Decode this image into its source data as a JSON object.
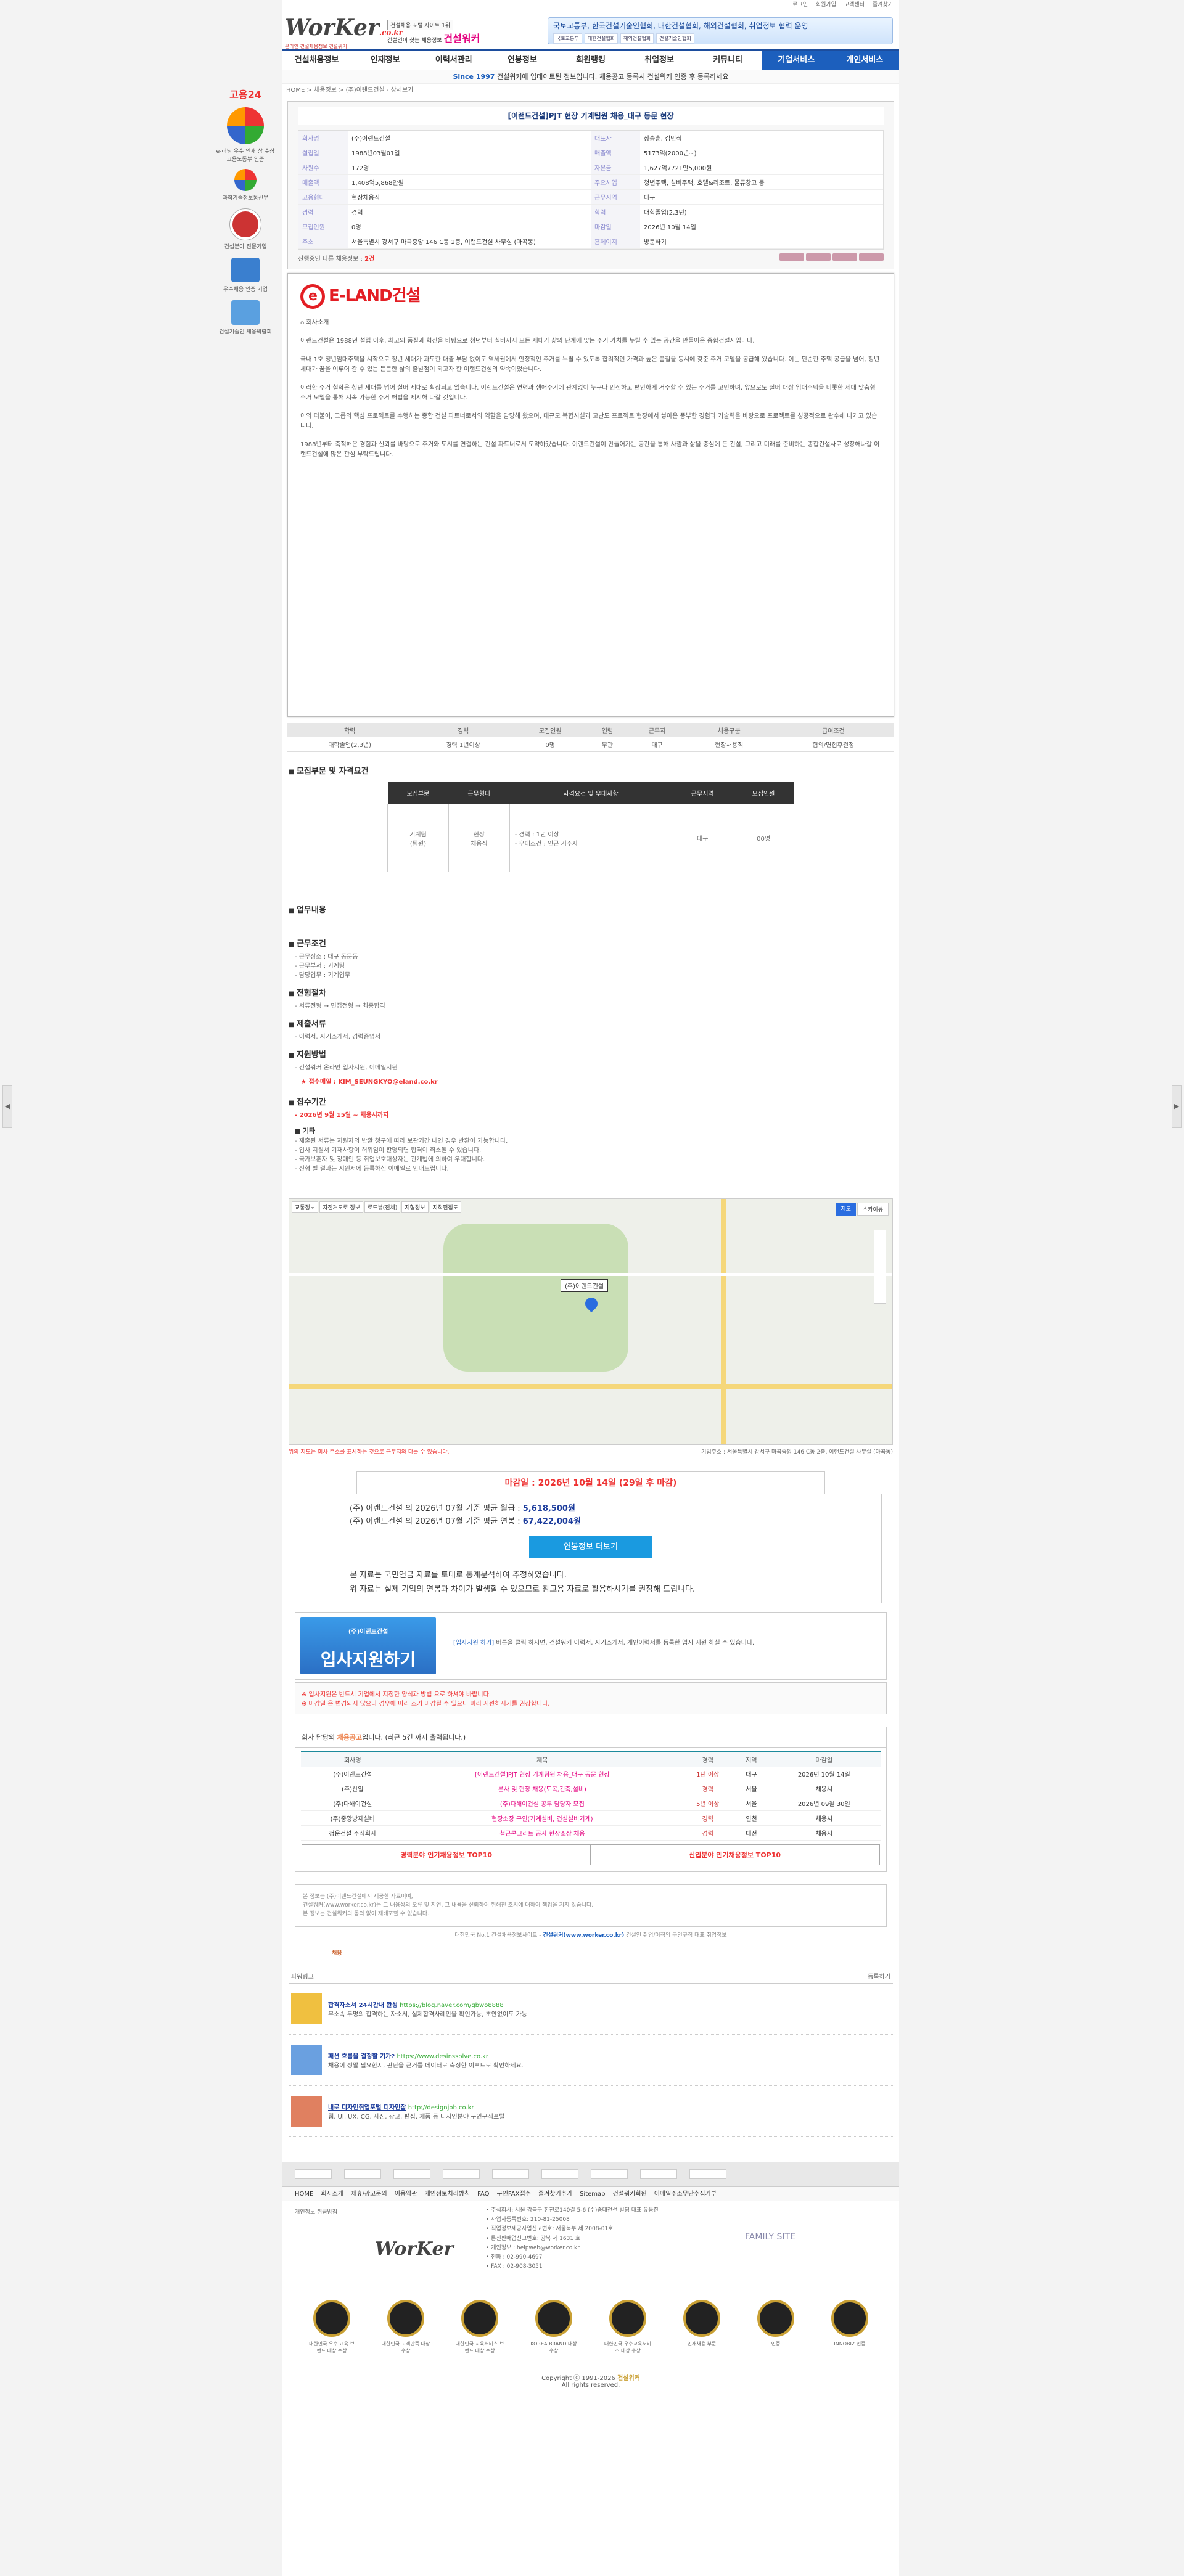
{
  "top_links": [
    "로그인",
    "회원가입",
    "고객센터",
    "즐겨찾기"
  ],
  "header": {
    "logo": "WorKer",
    "logo_suffix": ".co.kr",
    "logo_sub": "온라인 건설채용정보 건설워커",
    "badge": "건설채용 포털 사이트 1위",
    "slogan": "건설인이 찾는 채용정보",
    "brand": "건설워커",
    "banner_title": "국토교통부, 한국건설기술인협회, 대한건설협회, 해외건설협회, 취업정보 협력 운영",
    "banner_links": [
      "국토교통부",
      "대한건설협회",
      "해외건설협회",
      "건설기술인협회"
    ]
  },
  "menu": [
    "건설채용정보",
    "인재정보",
    "이력서관리",
    "연봉정보",
    "회원랭킹",
    "취업정보",
    "커뮤니티",
    "기업서비스",
    "개인서비스"
  ],
  "notice": {
    "highlight": "Since 1997",
    "text": "건설워커에 업데이트된 정보입니다. 채용공고 등록시 건설워커 인증 후 등록하세요"
  },
  "breadcrumb": "HOME  > 채용정보  > (주)이랜드건설 - 상세보기",
  "side": {
    "g24": "고용24",
    "badge1": "e-러닝 우수 인재 상 수상 고용노동부 인증",
    "badge2": "과학기술정보통신부",
    "seal": "건설분야 전문기업",
    "sq": "우수채용 인증 기업",
    "sq2": "건설기술인 채용박람회"
  },
  "summary": {
    "title": "[이랜드건설]PJT 현장 기계팀원 채용_대구 동문 현장",
    "rows": [
      [
        "회사명",
        "(주)이랜드건설",
        "대표자",
        "장승훈, 김민식"
      ],
      [
        "설립일",
        "1988년03월01일",
        "매출액",
        "5173억(2000년~)"
      ],
      [
        "사원수",
        "172명",
        "자본금",
        "1,627억7721만5,000원"
      ],
      [
        "매출액",
        "1,408억5,868만원",
        "주요사업",
        "청년주택, 실버주택, 호텔&리조트, 물류창고 등"
      ],
      [
        "고용형태",
        "현장채용직",
        "근무지역",
        "대구"
      ],
      [
        "경력",
        "경력",
        "학력",
        "대학졸업(2,3년)"
      ],
      [
        "모집인원",
        "0명",
        "마감일",
        "2026년 10월 14일"
      ],
      [
        "주소",
        "서울특별시 강서구 마곡중앙 146 C동 2층, 이랜드건설 사무실 (마곡동)",
        "홈페이지",
        "방문하기"
      ]
    ],
    "count_label": "진행중인 다른 채용정보 :",
    "count": "2건"
  },
  "detail": {
    "logo": "E-LAND건설",
    "menu_label": "회사소개",
    "paras": [
      "이랜드건설은 1988년 설립 이후, 최고의 품질과 혁신을 바탕으로 청년부터 실버까지 모든 세대가 삶의 단계에 맞는 주거 가치를 누릴 수 있는 공간을 만들어온 종합건설사입니다.",
      "국내 1호 청년임대주택을 시작으로 청년 세대가 과도한 대출 부담 없이도 역세권에서 안정적인 주거를 누릴 수 있도록 합리적인 가격과 높은 품질을 동시에 갖춘 주거 모델을 공급해 왔습니다. 이는 단순한 주택 공급을 넘어, 청년 세대가 꿈을 이루어 갈 수 있는 든든한 삶의 출발점이 되고자 한 이랜드건설의 약속이었습니다.",
      "이러한 주거 철학은 청년 세대를 넘어 실버 세대로 확장되고 있습니다. 이랜드건설은 연령과 생애주기에 관계없이 누구나 안전하고 편안하게 거주할 수 있는 주거를 고민하며, 앞으로도 실버 대상 임대주택을 비롯한 세대 맞춤형 주거 모델을 통해 지속 가능한 주거 해법을 제시해 나갈 것입니다.",
      "이와 더불어, 그룹의 핵심 프로젝트를 수행하는 종합 건설 파트너로서의 역할을 담당해 왔으며, 대규모 복합시설과 고난도 프로젝트 현장에서 쌓아온 풍부한 경험과 기술력을 바탕으로 프로젝트를 성공적으로 완수해 나가고 있습니다.",
      "1988년부터 축적해온 경험과 신뢰를 바탕으로 주거와 도시를 연결하는 건설 파트너로서 도약하겠습니다. 이랜드건설이 만들어가는 공간을 통해 사람과 삶을 중심에 둔 건설, 그리고 미래를 준비하는 종합건설사로 성장해나갈 이랜드건설에 많은 관심 부탁드립니다."
    ]
  },
  "conditions": {
    "headers": [
      "학력",
      "경력",
      "모집인원",
      "연령",
      "근무지",
      "채용구분",
      "급여조건"
    ],
    "values": [
      "대학졸업(2,3년)",
      "경력 1년이상",
      "0명",
      "무관",
      "대구",
      "현장채용직",
      "협의/면접후결정"
    ]
  },
  "sections": {
    "req": "모집부문 및 자격요건",
    "job": "업무내용",
    "work": "근무조건",
    "proc": "전형절차",
    "docs": "제출서류",
    "apply": "지원방법",
    "period": "접수기간",
    "etc": "기타"
  },
  "req_table": {
    "headers": [
      "모집부문",
      "근무형태",
      "자격요건 및 우대사항",
      "근무지역",
      "모집인원"
    ],
    "row": [
      "기계팀\n(팀원)",
      "현장\n채용직",
      "- 경력 : 1년 이상\n- 우대조건 : 인근 거주자",
      "대구",
      "00명"
    ]
  },
  "work_lines": [
    "- 근무장소 : 대구 동문동",
    "- 근무부서 : 기계팀",
    "- 담당업무 : 기계업무"
  ],
  "proc_line": "- 서류전형 → 면접전형 → 최종합격",
  "docs_line": "- 이력서, 자기소개서, 경력증명서",
  "apply_lines": [
    "- 건설워커 온라인 입사지원, 이메일지원"
  ],
  "apply_email": "★ 접수메일 : KIM_SEUNGKYO@eland.co.kr",
  "period_line": "- 2026년 9월 15일 ~ 채용시까지",
  "etc_lines": [
    "- 제출된 서류는 지원자의 반환 청구에 따라 보관기간 내인 경우 반환이 가능합니다.",
    "- 입사 지원서 기재사항이 허위임이 판명되면 합격이 취소될 수 있습니다.",
    "- 국가보훈자 및 장애인 등 취업보호대상자는 관계법에 의하여 우대합니다.",
    "- 전형 별 결과는 지원서에 등록하신 이메일로 안내드립니다."
  ],
  "map": {
    "tabs": [
      "교통정보",
      "자전거도로 정보",
      "로드뷰(전체)",
      "지형정보",
      "지적편집도"
    ],
    "marker": "(주)이랜드건설",
    "btn1": "지도",
    "btn2": "스카이뷰"
  },
  "map_warn": "위의 지도는 회사 주소를 표시하는 것으로 근무지와 다를 수 있습니다.",
  "map_addr": "기업주소 : 서울특별시 강서구 마곡중앙 146 C동 2층, 이랜드건설 사무실 (마곡동)",
  "deadline": "마감일 : 2026년 10월 14일 (29일 후 마감)",
  "salary": {
    "l1_pre": "(주) 이랜드건설 의 2026년 07월 기준 평균 월급 :",
    "l1": "5,618,500원",
    "l2_pre": "(주) 이랜드건설 의 2026년 07월 기준 평균 연봉 :",
    "l2": "67,422,004원",
    "btn": "연봉정보 더보기",
    "n1": "본 자료는 국민연금 자료를 토대로 통계분석하여 추정하였습니다.",
    "n2": "위 자료는 실제 기업의 연봉과 차이가 발생할 수 있으므로 참고용 자료로 활용하시기를 권장해 드립니다."
  },
  "apply_box": {
    "company": "(주)이랜드건설",
    "btn": "입사지원하기",
    "desc_link": "[입사지원 하기]",
    "desc": "버튼을 클릭 하시면, 건설워커 이력서, 자기소개서, 개인이력서를 등록한 입사 지원 하실 수 있습니다."
  },
  "warn": {
    "l1": "※ 입사지원은 반드시 기업에서 지정한 양식과 방법 으로 하셔야 바랍니다.",
    "l2": "※ 마감일 은 변경되지 않으나 경우에 따라 조기 마감될 수 있으니 미리 지원하시기를 권장합니다."
  },
  "other": {
    "ttl_pre": "회사 담당의",
    "ttl_hl": "채용공고",
    "ttl_post": "입니다.  (최근 5건 까지 출력됩니다.)",
    "headers": [
      "회사명",
      "제목",
      "경력",
      "지역",
      "마감일"
    ],
    "rows": [
      [
        "(주)이랜드건설",
        "[이랜드건설]PJT 현장 기계팀원 채용_대구 동문 현장",
        "1년 이상",
        "대구",
        "2026년 10월 14일"
      ],
      [
        "(주)산일",
        "본사 및 현장 채용(토목,건축,설비)",
        "경력",
        "서울",
        "채용시"
      ],
      [
        "(주)다해이건설",
        "(주)다해이건설 공무 담당자 모집",
        "5년 이상",
        "서울",
        "2026년 09월 30일"
      ],
      [
        "(주)중앙방재설비",
        "현장소장 구인(기계설비, 건설설비기계)",
        "경력",
        "인천",
        "채용시"
      ],
      [
        "청운건설 주식회사",
        "철근콘크리트 공사 현장소장 채용",
        "경력",
        "대전",
        "채용시"
      ]
    ]
  },
  "top10": [
    "경력분야 인기채용정보 TOP10",
    "신입분야 인기채용정보 TOP10"
  ],
  "source": {
    "lines": [
      "본 정보는 (주)이랜드건설에서 제공한 자료이며,",
      "건설워커(www.worker.co.kr)는 그 내용상의 오류 및 지연, 그 내용을 신뢰하여 취해진 조치에 대하여 책임을 지지 않습니다.",
      "본 정보는 건설워커의 동의 없이 재배포할 수 없습니다."
    ],
    "note_pre": "대한민국 No.1 건설채용정보사이트 -",
    "note_link": "건설워커(www.worker.co.kr)",
    "note_post": "건설인 취업/이직의 구인구직 대표 취업정보",
    "tag": "채용"
  },
  "ads": {
    "head": "파워링크",
    "more": "등록하기",
    "items": [
      {
        "t": "합격자소서 24시간내 완성",
        "u": "https://blog.naver.com/gbwo8888",
        "d": "무소속 두명의 합격하는 자소서, 실제합격사례만을 확인가능, 초안없이도 가능"
      },
      {
        "t": "패션 흐름을 결정할 기가?",
        "u": "https://www.desinssolve.co.kr",
        "d": "채용이 정말 필요한지, 판단을 근거를 데이터로 측정한 이포트로 확인하세요."
      },
      {
        "t": "내로 디자인취업포털 디자인잡",
        "u": "http://designjob.co.kr",
        "d": "웹, UI, UX, CG, 사진, 광고, 편집, 제품 등 디자인분야 구인구직포털"
      }
    ]
  },
  "footer": {
    "links": [
      "HOME",
      "회사소개",
      "제휴/광고문의",
      "이용약관",
      "개인정보처리방침",
      "FAQ",
      "구인FAX접수",
      "즐겨찾기추가",
      "Sitemap",
      "건설워커회원",
      "이메일주소무단수집거부"
    ],
    "left": "개인정보 취급방침",
    "logo": "WorKer",
    "lines": [
      "주식회사: 서울 강북구 한천로140길 5-6 (수)중대전선 빌딩 대표 유동한",
      "사업자등록번호: 210-81-25008",
      "직업정보제공사업신고번호: 서울북부 제 2008-01호",
      "통신판매업신고번호: 강북 제 1631 호",
      "개인정보 : helpweb@worker.co.kr",
      "전화 : 02-990-4697",
      "FAX : 02-908-3051"
    ],
    "family": "FAMILY SITE",
    "badges": [
      "대한민국 우수 교육 브랜드 대상 수상",
      "대한민국 고객만족 대상 수상",
      "대한민국 교육서비스 브랜드 대상 수상",
      "KOREA BRAND 대상 수상",
      "대한민국 우수교육서비스 대상 수상",
      "인재채용 부문",
      "인증",
      "INNOBIZ 인증"
    ],
    "copy": "Copyright ⓒ 1991-2026",
    "copy_brand": "건설위커",
    "rights": "All rights reserved."
  }
}
